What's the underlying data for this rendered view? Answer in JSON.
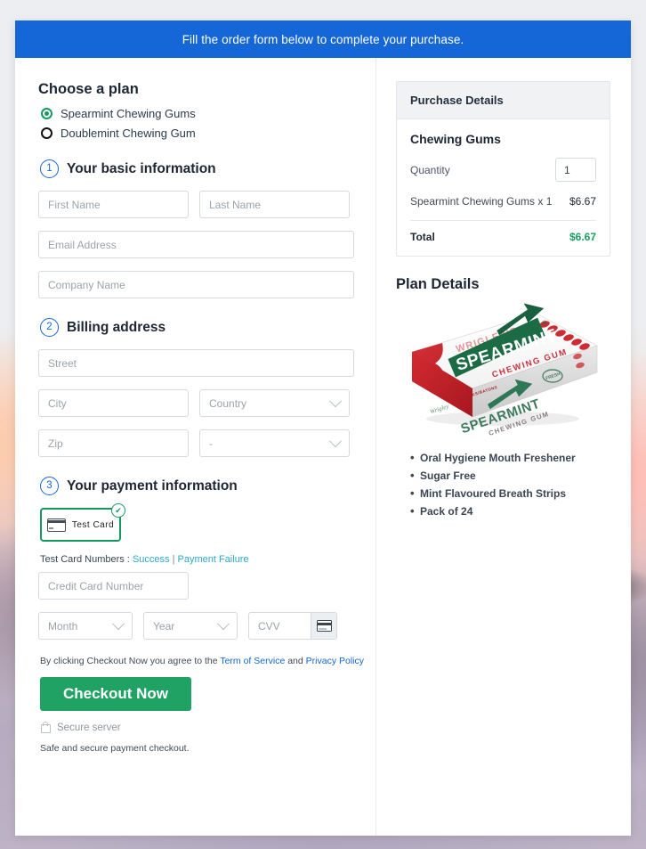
{
  "banner": {
    "message": "Fill the order form below to complete your purchase."
  },
  "plan": {
    "heading": "Choose a plan",
    "options": [
      {
        "label": "Spearmint Chewing Gums",
        "selected": true
      },
      {
        "label": "Doublemint Chewing Gum",
        "selected": false
      }
    ]
  },
  "steps": [
    {
      "number": "1",
      "title": "Your basic information"
    },
    {
      "number": "2",
      "title": "Billing address"
    },
    {
      "number": "3",
      "title": "Your payment information"
    }
  ],
  "basic_info": {
    "first_name_placeholder": "First Name",
    "last_name_placeholder": "Last Name",
    "email_placeholder": "Email Address",
    "company_placeholder": "Company Name"
  },
  "billing": {
    "street_placeholder": "Street",
    "city_placeholder": "City",
    "country_placeholder": "Country",
    "zip_placeholder": "Zip",
    "state_placeholder": "-"
  },
  "payment": {
    "tile_label": "Test  Card",
    "tile_icon": "credit-card-icon",
    "tile_check": "✔",
    "test_numbers_label": "Test Card Numbers :",
    "success_link": "Success",
    "separator": "|",
    "failure_link": "Payment Failure",
    "card_number_placeholder": "Credit Card Number",
    "month_placeholder": "Month",
    "year_placeholder": "Year",
    "cvv_placeholder": "CVV",
    "cvv_icon": "card-back-icon"
  },
  "footer": {
    "terms_prefix": "By clicking Checkout Now you agree to the",
    "terms_link": "Term of Service",
    "terms_and": "and",
    "privacy_link": "Privacy Policy",
    "checkout_label": "Checkout Now",
    "secure_label": "Secure server",
    "safe_label": "Safe and secure payment checkout."
  },
  "purchase": {
    "panel_title": "Purchase Details",
    "product_title": "Chewing Gums",
    "quantity_label": "Quantity",
    "quantity_value": "1",
    "line_item": "Spearmint Chewing Gums x 1",
    "line_amount": "$6.67",
    "total_label": "Total",
    "total_amount": "$6.67"
  },
  "plan_details": {
    "heading": "Plan Details",
    "product_image_alt": "spearmint-gum-box-image",
    "brand_top": "WRIGLEY'S",
    "brand_main": "SPEARMINT",
    "brand_sub": "CHEWING GUM",
    "features": [
      "Oral Hygiene Mouth Freshener",
      "Sugar Free",
      "Mint Flavoured Breath Strips",
      "Pack of 24"
    ]
  },
  "colors": {
    "banner_blue": "#1566d6",
    "accent_green": "#21a265",
    "total_green": "#16a15f",
    "link_blue": "#1566d6",
    "link_teal": "#2aa9c9"
  }
}
